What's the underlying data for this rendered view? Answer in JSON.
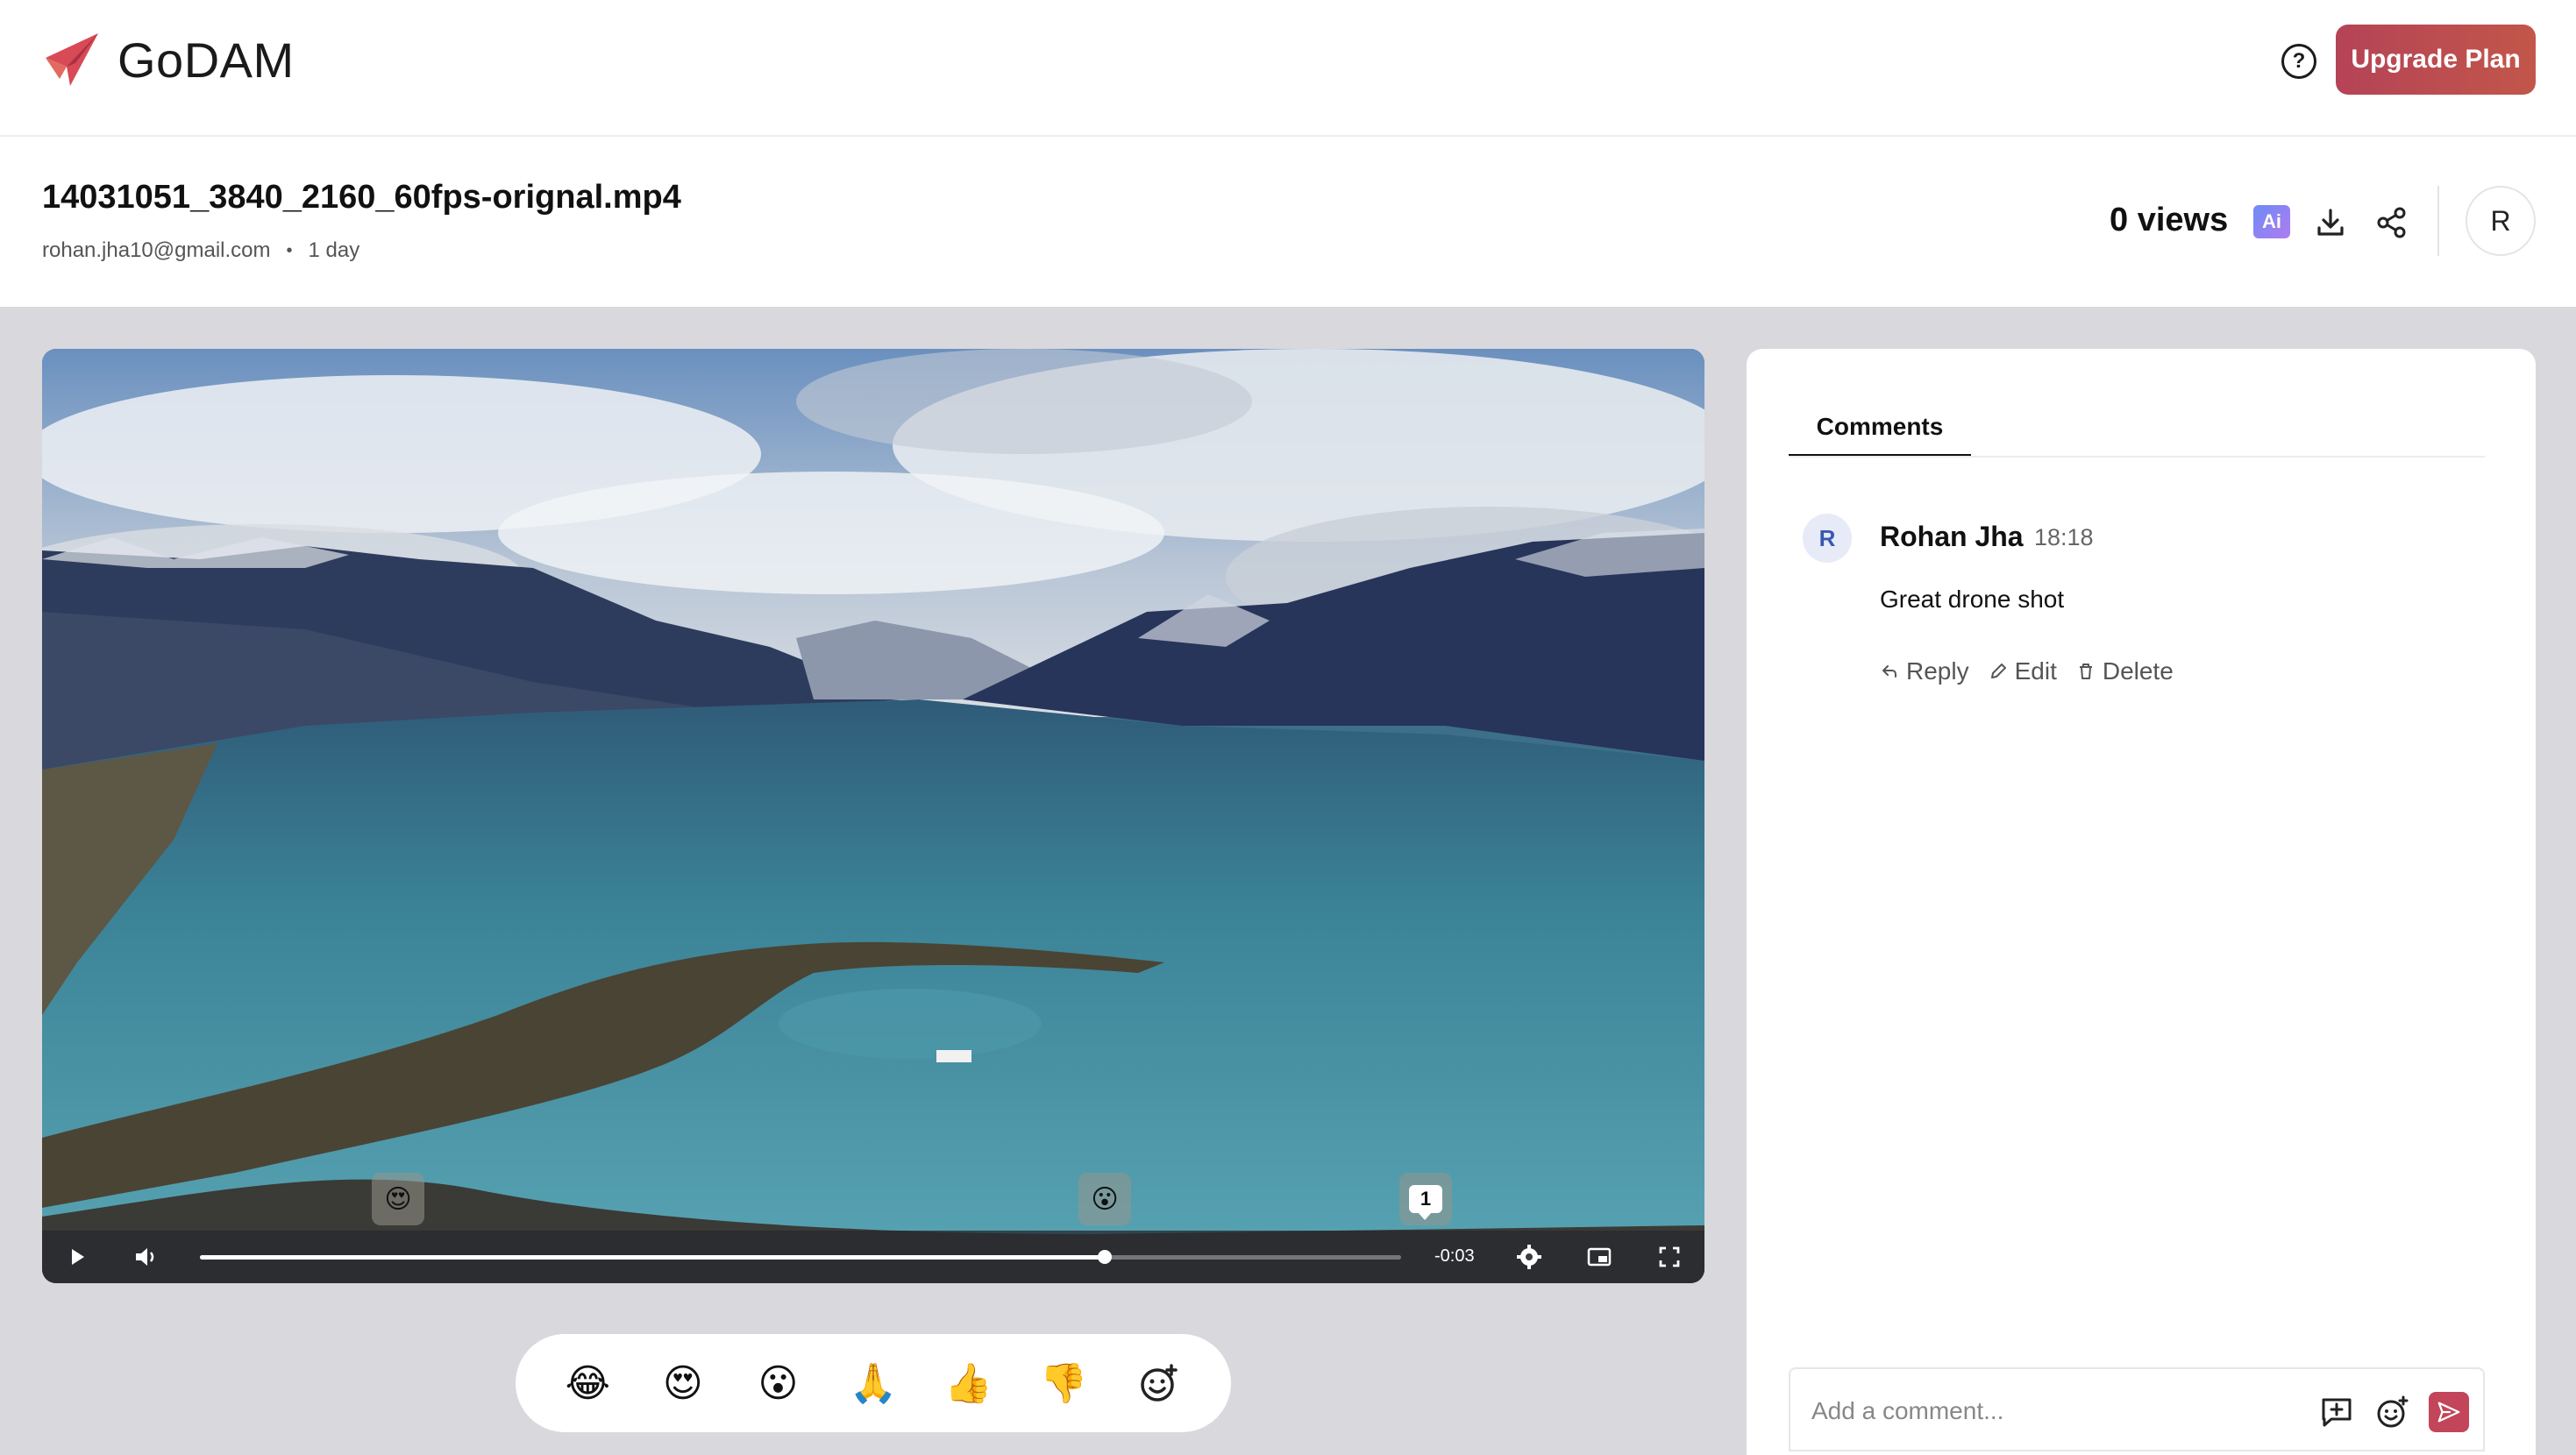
{
  "app": {
    "name": "GoDAM"
  },
  "header": {
    "upgrade_label": "Upgrade Plan",
    "help_icon": "help-circle-icon"
  },
  "file": {
    "title": "14031051_3840_2160_60fps-orignal.mp4",
    "owner": "rohan.jha10@gmail.com",
    "age": "1 day",
    "views": "0 views",
    "ai_label": "Ai",
    "avatar_initial": "R"
  },
  "player": {
    "time_remaining": "-0:03",
    "progress": 0.753,
    "markers": [
      {
        "emoji": "😍",
        "label": "heart-eyes-marker"
      },
      {
        "emoji": "😮",
        "label": "surprised-marker"
      }
    ],
    "comment_marker_count": "1"
  },
  "reactions": [
    "😂",
    "😍",
    "😮",
    "🙏",
    "👍",
    "👎"
  ],
  "comments_panel": {
    "tab_label": "Comments",
    "comments": [
      {
        "initial": "R",
        "author": "Rohan Jha",
        "timestamp": "18:18",
        "text": "Great drone shot",
        "actions": {
          "reply": "Reply",
          "edit": "Edit",
          "delete": "Delete"
        }
      }
    ],
    "input_placeholder": "Add a comment..."
  },
  "colors": {
    "brand": "#c2455a",
    "upgrade_gradient_start": "#b54356",
    "upgrade_gradient_end": "#c2564a"
  }
}
